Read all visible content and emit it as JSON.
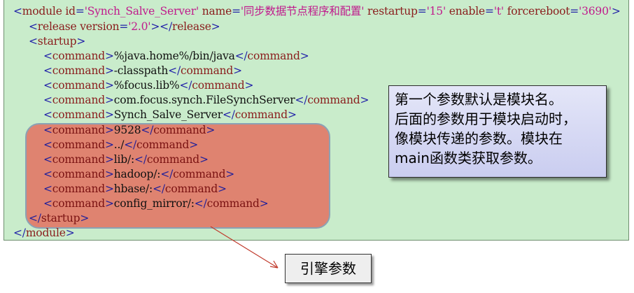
{
  "xml": {
    "module_open": {
      "lt": "<",
      "name": "module",
      "attrs": [
        {
          "key": "id",
          "value": "'Synch_Salve_Server'"
        },
        {
          "key": "name",
          "value": "'同步数据节点程序和配置'"
        },
        {
          "key": "restartup",
          "value": "'15'"
        },
        {
          "key": "enable",
          "value": "'t'"
        },
        {
          "key": "forcereboot",
          "value": "'3690'"
        }
      ],
      "gt": ">"
    },
    "release": {
      "open_lt": "<",
      "name": "release",
      "attr_key": "version",
      "attr_value": "'2.0'",
      "open_gt": ">",
      "close_lt": "</",
      "close_gt": ">"
    },
    "startup_open": "startup",
    "commands": [
      "%java.home%/bin/java",
      "-classpath",
      "%focus.lib%",
      "com.focus.synch.FileSynchServer",
      "Synch_Salve_Server",
      "9528",
      "../",
      "lib/:",
      "hadoop/:",
      "hbase/:",
      "config_mirror/:"
    ],
    "command_tag": "command",
    "startup_close": "startup",
    "module_close": "module"
  },
  "note": {
    "lines": [
      "第一个参数默认是模块名。",
      "后面的参数用于模块启动时，",
      "像模块传递的参数。模块在",
      "main函数类获取参数。"
    ]
  },
  "label": {
    "text": "引擎参数"
  },
  "colors": {
    "panel_bg": "#c9eccb",
    "highlight_fill": "#e0806e",
    "highlight_border": "#8aa0b4",
    "tag": "#2222a8",
    "element_name": "#8a1d1d",
    "attr_value": "#c01a8c",
    "arrow": "#c0392b"
  }
}
